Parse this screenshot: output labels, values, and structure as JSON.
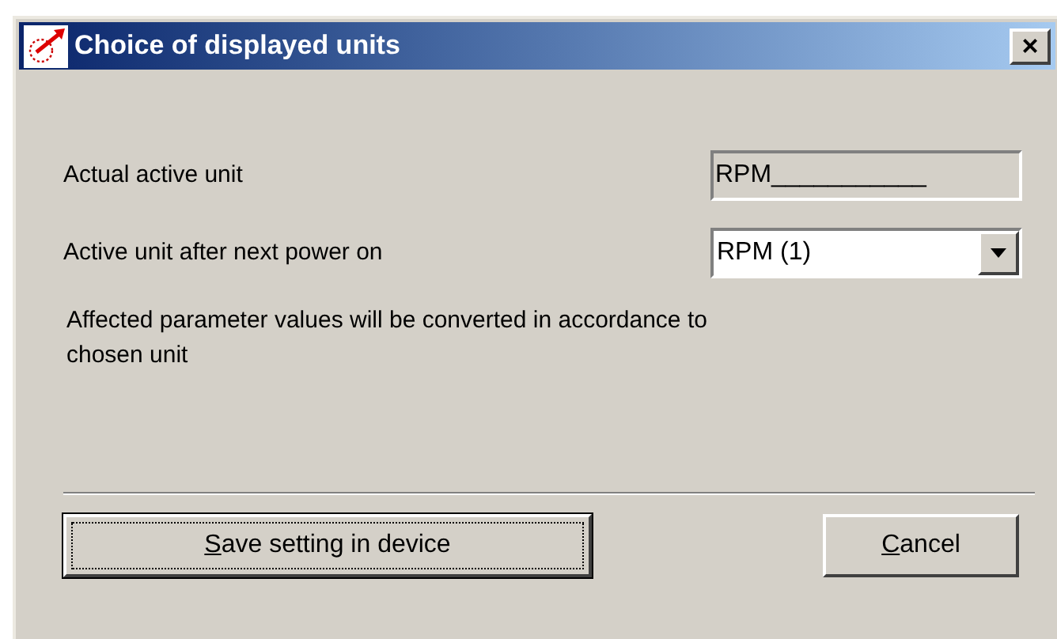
{
  "window": {
    "title": "Choice of displayed units",
    "close_label": "×"
  },
  "fields": [
    {
      "kind": "readonly",
      "label": "Actual active unit",
      "value": "RPM___________"
    },
    {
      "kind": "dropdown",
      "label": "Active unit after next power on",
      "value": "RPM (1)"
    }
  ],
  "note": "Affected parameter values will be converted in accordance to chosen unit",
  "buttons": [
    {
      "mnemonic": "S",
      "rest": "ave setting in device",
      "focused": true
    },
    {
      "mnemonic": "C",
      "rest": "ancel",
      "focused": false
    }
  ]
}
